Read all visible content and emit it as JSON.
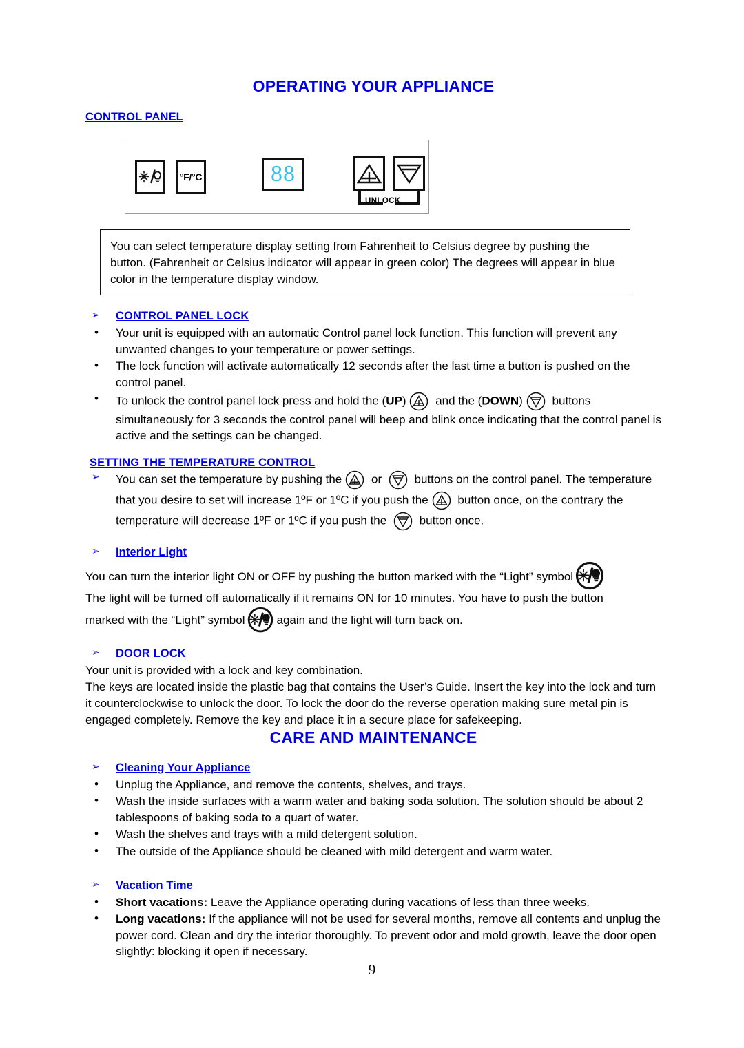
{
  "document": {
    "page_number": "9",
    "accent_color": "#0000e8",
    "display_color": "#3cc0ea"
  },
  "section1": {
    "title": "OPERATING YOUR APPLIANCE",
    "control_panel_heading": "CONTROL PANEL",
    "control_panel": {
      "light_button_label": "light-symbol",
      "unit_button_label": "°F/°C",
      "display_value": "88",
      "up_button_label": "up-plus",
      "down_button_label": "down-minus",
      "unlock_label": "UNLOCK"
    },
    "note_box": "You can select temperature display setting from Fahrenheit to Celsius degree by pushing the button.  (Fahrenheit or Celsius indicator will appear in green color) The degrees will appear in blue color in the temperature display window.",
    "control_panel_lock": {
      "heading": "CONTROL PANEL LOCK",
      "bullets": [
        "Your unit is equipped with an automatic Control panel lock function.  This function will prevent any unwanted changes to your temperature or power settings.",
        "The lock function will activate automatically 12 seconds after the last time a button is pushed on the control panel."
      ],
      "unlock_bullet": {
        "part1": "To unlock the control panel lock press and hold the (",
        "up_word": "UP",
        "part2": ")",
        "part3": " and the (",
        "down_word": "DOWN",
        "part4": ")",
        "part5": " buttons simultaneously for 3 seconds the control panel will beep and blink once indicating that the control panel is active and the settings can be changed."
      }
    },
    "temperature_control": {
      "heading": "SETTING THE TEMPERATURE CONTROL",
      "bullet": {
        "part1": "You can set the temperature by pushing the",
        "part2": " or ",
        "part3": " buttons on the control panel.  The temperature that you desire to set will increase 1ºF or 1ºC if you push the",
        "part4": " button once, on the contrary the temperature will decrease 1ºF or 1ºC if you push the ",
        "part5": " button once."
      }
    },
    "interior_light": {
      "heading": "Interior Light",
      "line1": "You can turn the interior light ON or OFF by pushing the button marked with the “Light” symbol",
      "line2": "The light will be turned off automatically if it remains ON for 10 minutes. You have to push the button",
      "line3_part1": "marked with the “Light” symbol",
      "line3_part2": "again and the light will turn back on."
    },
    "door_lock": {
      "heading": "DOOR LOCK",
      "line1": "Your unit is provided with a lock and key combination.",
      "line2": "The keys are located inside the plastic bag that contains the User’s Guide. Insert the key into the lock and turn it counterclockwise to unlock the door. To lock the door do the reverse operation making sure metal pin is engaged completely. Remove the key and place it in a secure place for safekeeping."
    }
  },
  "section2": {
    "title": "CARE AND MAINTENANCE",
    "cleaning": {
      "heading": "Cleaning Your Appliance",
      "bullets": [
        "Unplug the Appliance, and remove the contents, shelves, and trays.",
        "Wash the inside surfaces with a warm water and baking soda solution. The solution should be about 2 tablespoons of baking soda to a quart of water.",
        "Wash the shelves and trays with a mild detergent solution.",
        "The outside of the Appliance should be cleaned with mild detergent and warm water."
      ]
    },
    "vacation": {
      "heading": "Vacation Time",
      "short_label": "Short vacations:",
      "short_text": " Leave the Appliance operating during vacations of less than three weeks.",
      "long_label": "Long vacations:",
      "long_text": " If the appliance will not be used for several months, remove all contents and unplug the power cord.  Clean and dry the interior thoroughly.  To prevent odor and mold growth, leave the door open slightly: blocking it open if necessary."
    }
  }
}
